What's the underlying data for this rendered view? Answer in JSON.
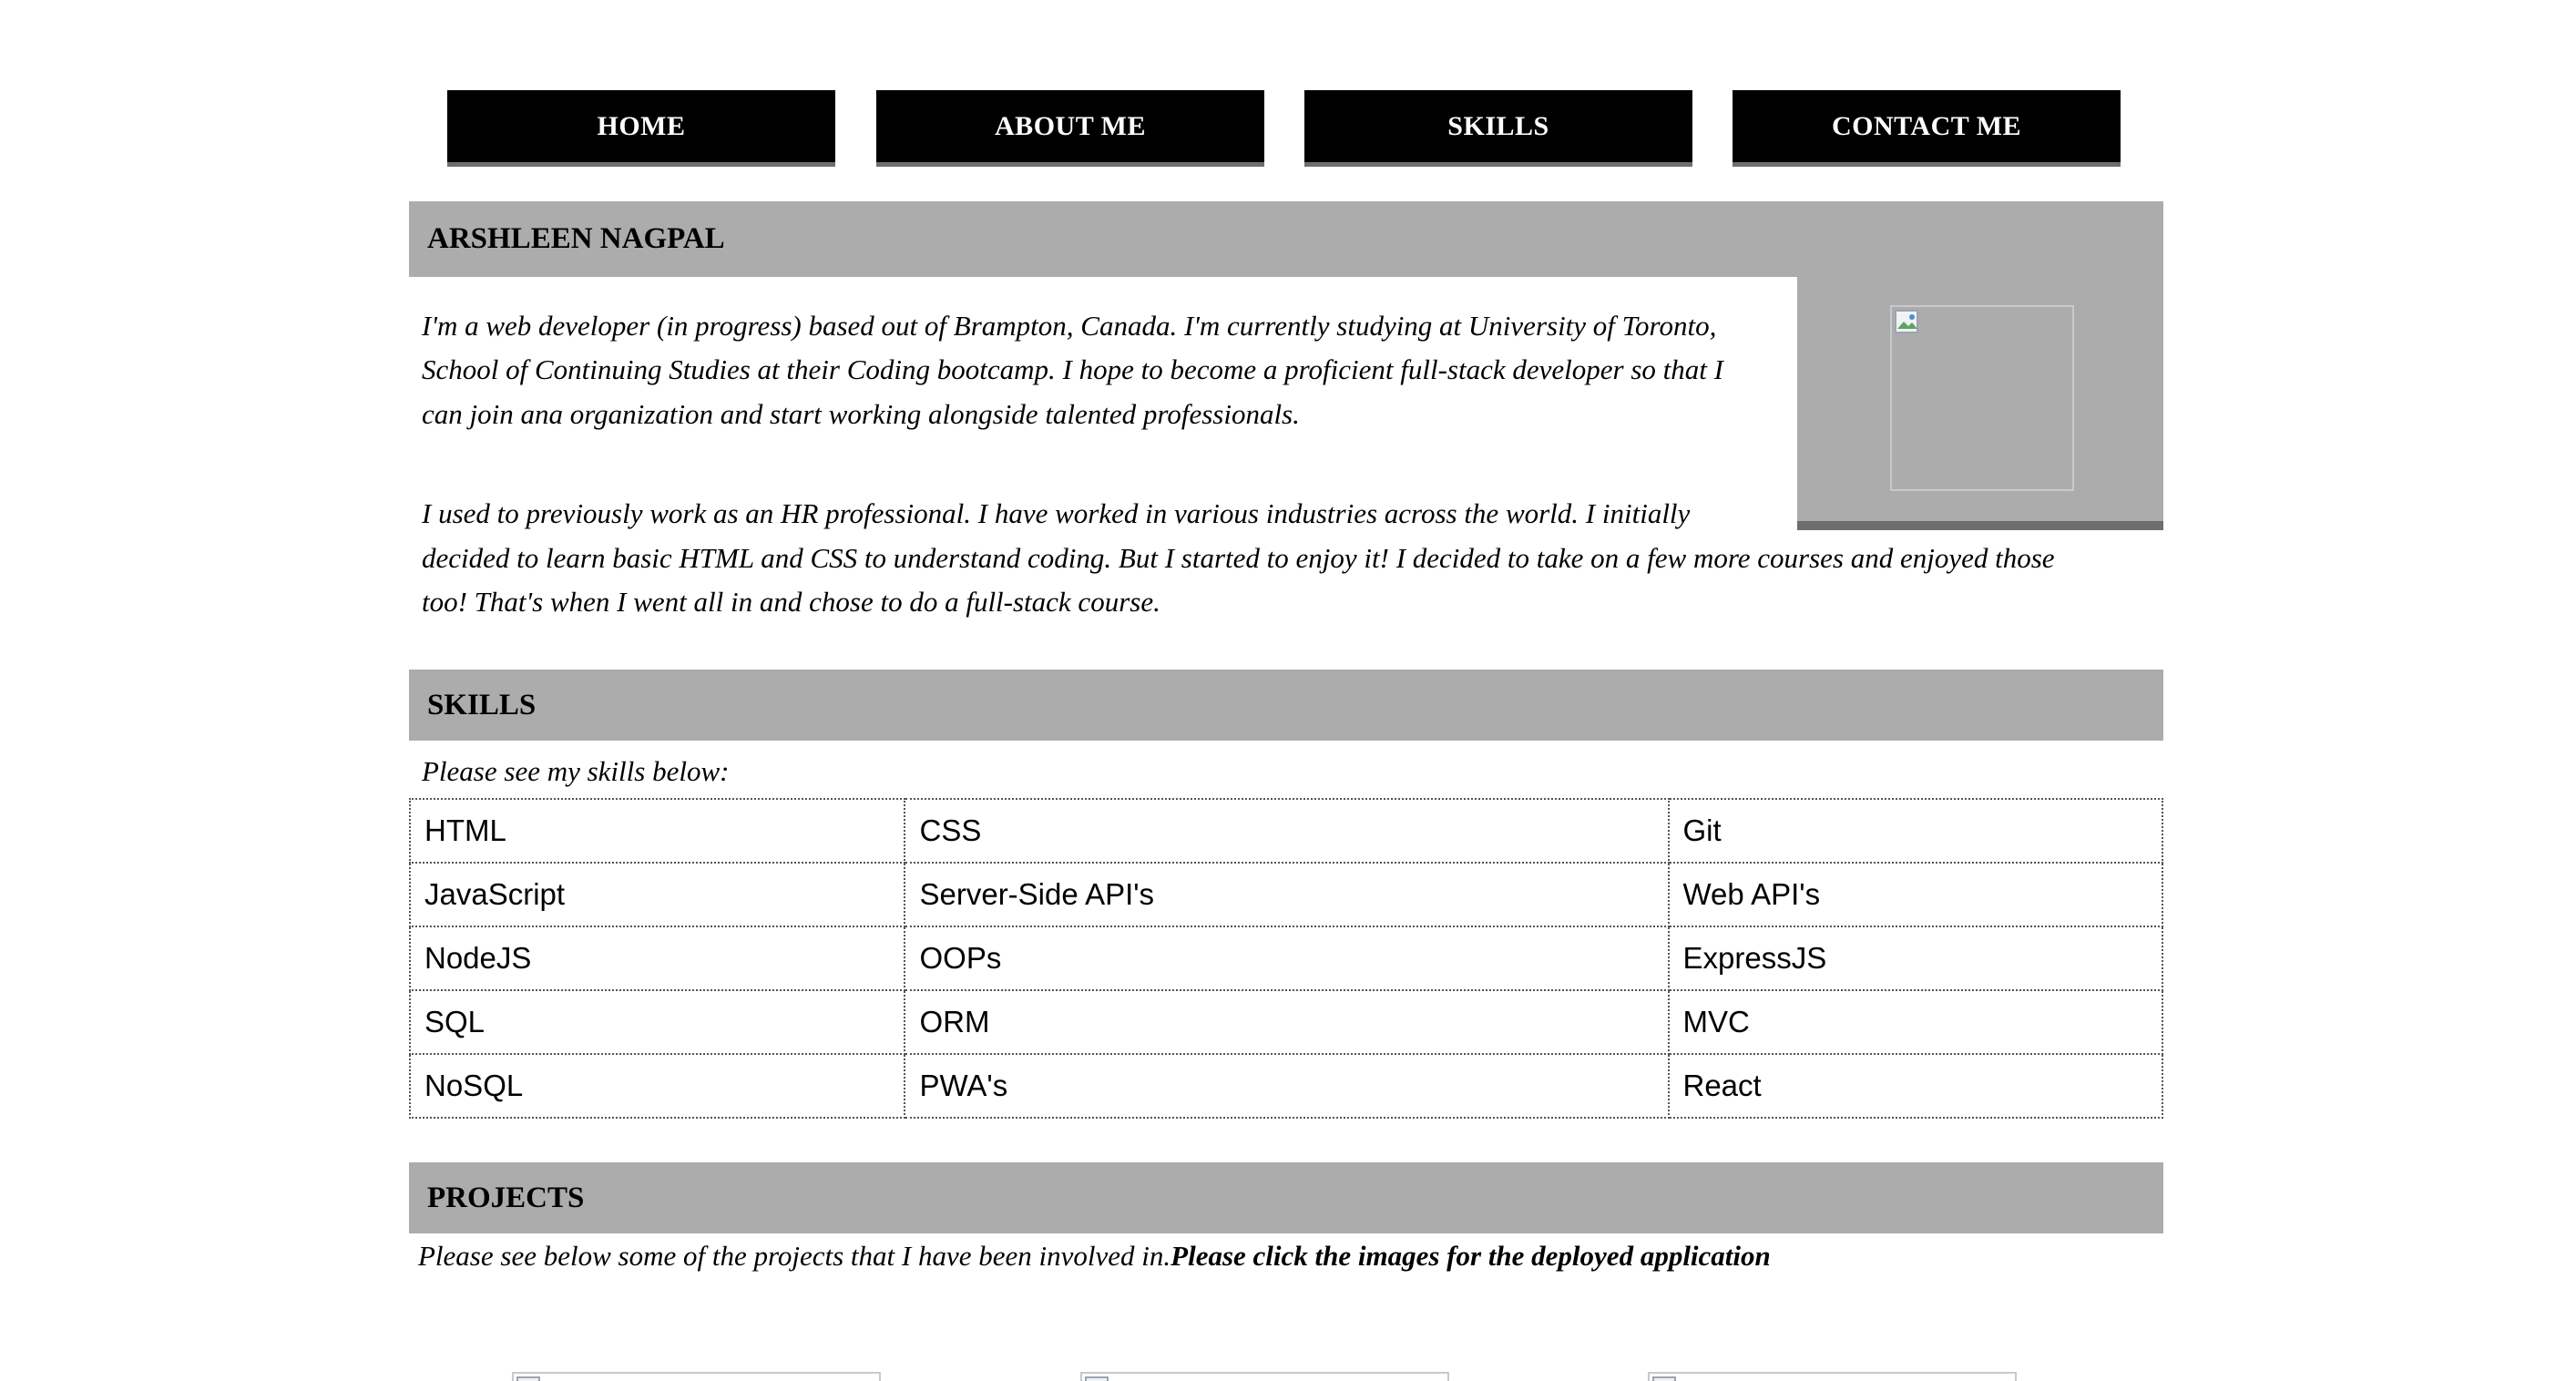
{
  "nav": {
    "items": [
      {
        "label": "HOME"
      },
      {
        "label": "ABOUT ME"
      },
      {
        "label": "SKILLS"
      },
      {
        "label": "CONTACT ME"
      }
    ]
  },
  "about": {
    "heading": "ARSHLEEN NAGPAL",
    "para1_lines": [
      "I'm a web developer (in progress) based out of Brampton, Canada. I'm currently studying at University of Toronto,",
      "School of Continuing Studies at their Coding bootcamp. I hope to become a proficient full-stack developer so that I",
      "can join ana organization and start working alongside talented professionals."
    ],
    "para2_lines": [
      "I used to previously work as an HR professional. I have worked in various industries across the world. I initially",
      "decided to learn basic HTML and CSS to understand coding. But I started to enjoy it! I decided to take on a few more courses and enjoyed those",
      "too! That's when I went all in and chose to do a full-stack course."
    ],
    "photo_icon": "broken-image-icon"
  },
  "skills": {
    "heading": "SKILLS",
    "intro": "Please see my skills below:",
    "rows": [
      [
        "HTML",
        "CSS",
        "Git"
      ],
      [
        "JavaScript",
        "Server-Side API's",
        "Web API's"
      ],
      [
        "NodeJS",
        "OOPs",
        "ExpressJS"
      ],
      [
        "SQL",
        "ORM",
        "MVC"
      ],
      [
        "NoSQL",
        "PWA's",
        "React"
      ]
    ]
  },
  "projects": {
    "heading": "PROJECTS",
    "intro": "Please see below some of the projects that I have been involved in.",
    "intro_bold": "Please click the images for the deployed application",
    "image_icon": "broken-image-icon"
  },
  "colors": {
    "nav_bg": "#000000",
    "nav_text": "#ffffff",
    "nav_shadow": "#6e6e6e",
    "header_bg": "#acacac"
  }
}
